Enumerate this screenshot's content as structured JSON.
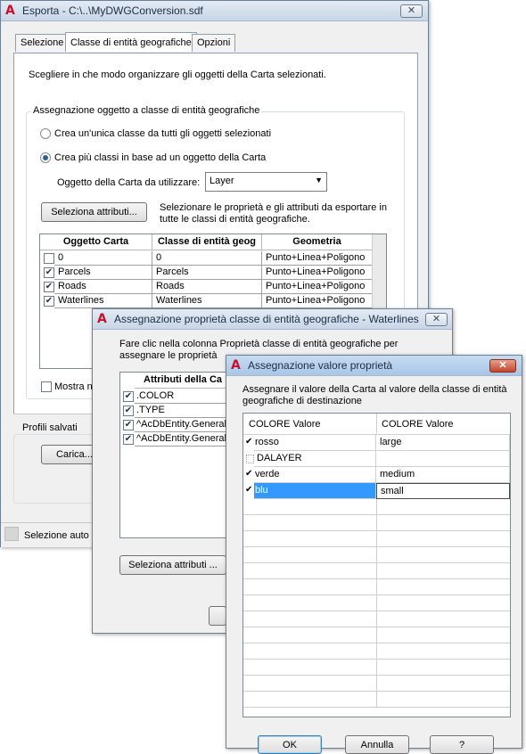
{
  "esporta": {
    "title": "Esporta - C:\\..\\MyDWGConversion.sdf",
    "close": "✕",
    "tabs": [
      "Selezione",
      "Classe di entità geografiche",
      "Opzioni"
    ],
    "intro": "Scegliere in che modo organizzare gli oggetti della Carta selezionati.",
    "group_label": "Assegnazione oggetto a classe di entità geografiche",
    "radio_single": "Crea un'unica classe da tutti gli oggetti selezionati",
    "radio_multi": "Crea più classi in base ad un oggetto della Carta",
    "object_label": "Oggetto della Carta da utilizzare:",
    "object_value": "Layer",
    "select_attr_button": "Seleziona attributi...",
    "select_attr_desc_1": "Selezionare le proprietà e gli attributi da esportare in",
    "select_attr_desc_2": "tutte le classi di entità geografiche.",
    "columns": [
      "Oggetto Carta",
      "Classe di entità geog",
      "Geometria"
    ],
    "rows": [
      {
        "obj": "0",
        "cls": "0",
        "geom": "Punto+Linea+Poligono",
        "checked": false
      },
      {
        "obj": "Parcels",
        "cls": "Parcels",
        "geom": "Punto+Linea+Poligono",
        "checked": true
      },
      {
        "obj": "Roads",
        "cls": "Roads",
        "geom": "Punto+Linea+Poligono",
        "checked": true
      },
      {
        "obj": "Waterlines",
        "cls": "Waterlines",
        "geom": "Punto+Linea+Poligono",
        "checked": true
      }
    ],
    "show_checkbox_label": "Mostra no",
    "saved_profiles": "Profili salvati",
    "load_button": "Carica...",
    "status": "Selezione auto"
  },
  "assegnazione_proprieta": {
    "title": "Assegnazione proprietà classe di entità geografiche - Waterlines",
    "close": "✕",
    "intro_1": "Fare clic nella colonna Proprietà classe di entità geografiche per",
    "intro_2": "assegnare le proprietà",
    "column": "Attributi della Ca",
    "rows": [
      {
        "label": ".COLOR",
        "checked": true
      },
      {
        "label": ".TYPE",
        "checked": true
      },
      {
        "label": "^AcDbEntity.General",
        "checked": true
      },
      {
        "label": "^AcDbEntity.General",
        "checked": true
      }
    ],
    "select_button": "Seleziona attributi ..."
  },
  "assegnazione_valore": {
    "title": "Assegnazione valore proprietà",
    "close": "✕",
    "intro_1": "Assegnare il valore della Carta al valore della classe di entità",
    "intro_2": "geografiche di destinazione",
    "col1": "COLORE Valore",
    "col2": "COLORE Valore",
    "rows": [
      {
        "src": "rosso",
        "dst": "large",
        "checked": true
      },
      {
        "src": "DALAYER",
        "dst": "",
        "checked": false
      },
      {
        "src": "verde",
        "dst": "medium",
        "checked": true
      },
      {
        "src": "blu",
        "dst": "small",
        "checked": true
      }
    ],
    "ok": "OK",
    "cancel": "Annulla",
    "help": "?"
  },
  "icons": {
    "app": "autocad-logo-icon",
    "check": "checkmark-icon",
    "dropdown": "chevron-down-icon"
  },
  "colors": {
    "selection": "#3399ff",
    "app_icon": "#c8102e"
  }
}
